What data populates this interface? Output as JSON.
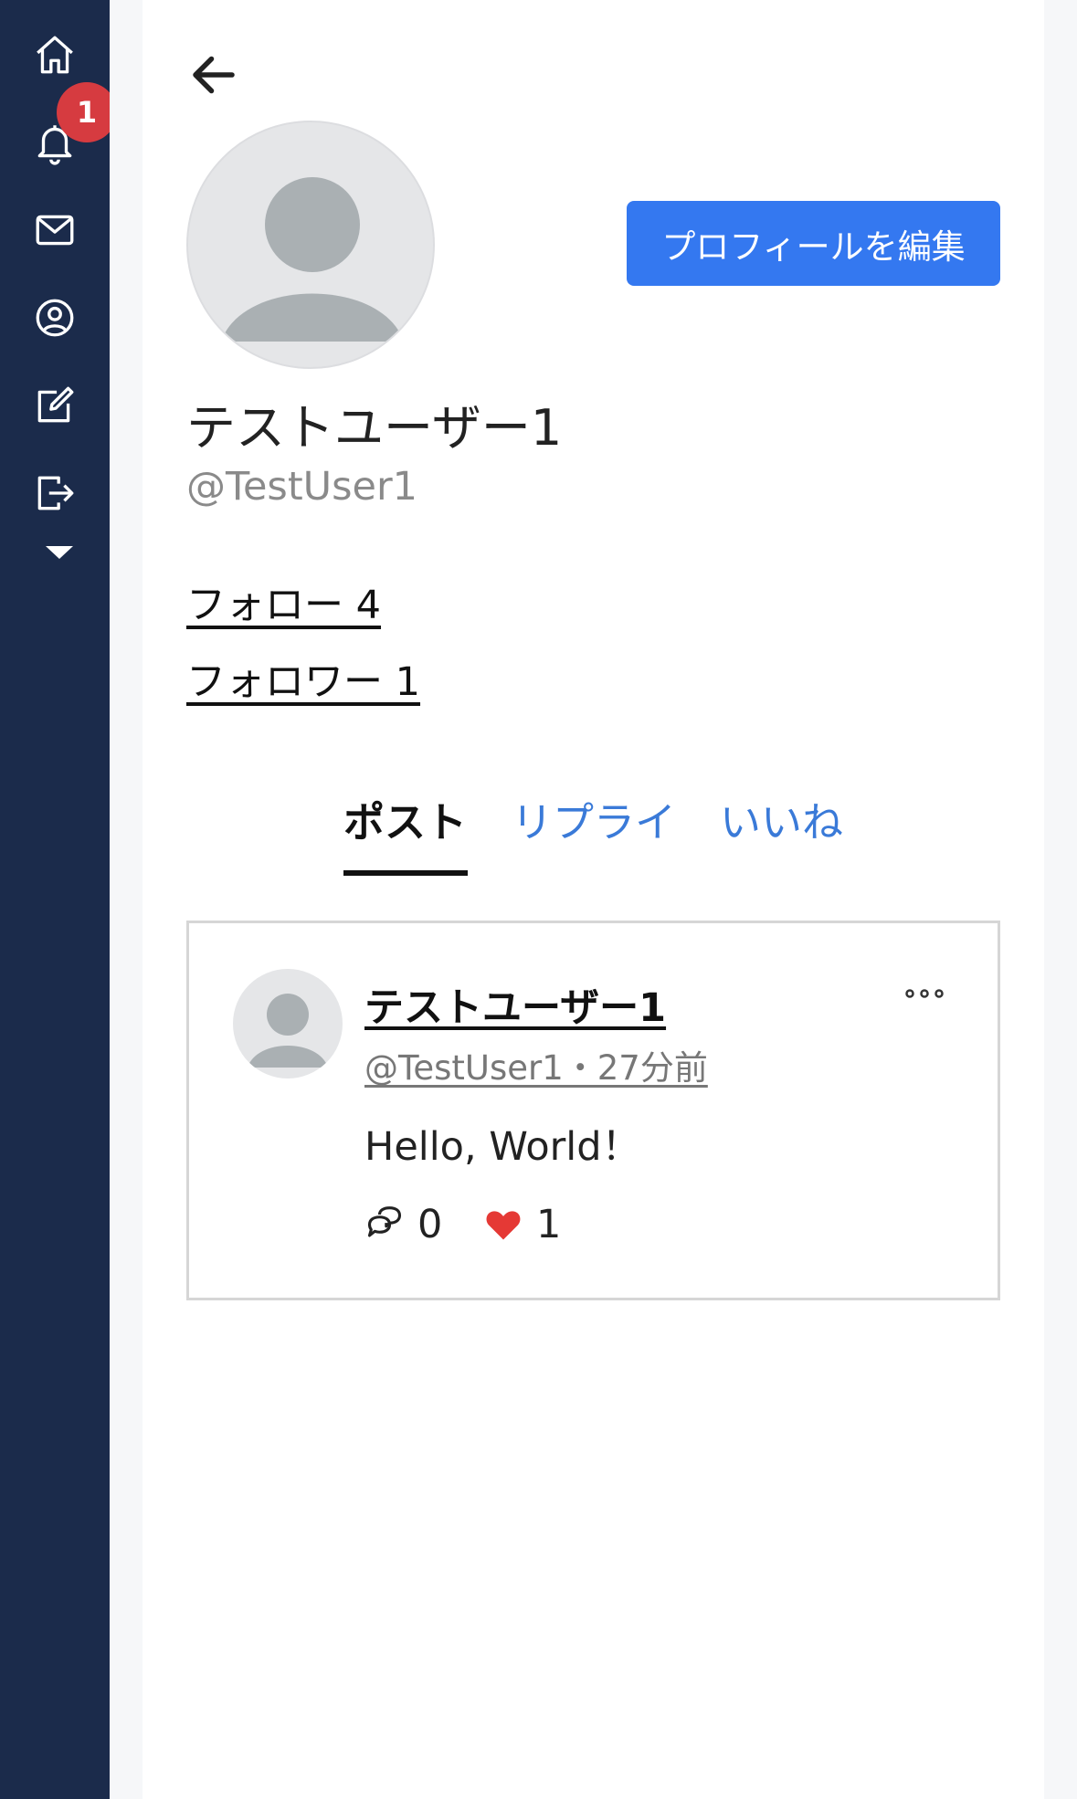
{
  "sidebar": {
    "icons": [
      "home-icon",
      "bell-icon",
      "mail-icon",
      "user-circle-icon",
      "edit-icon",
      "logout-icon"
    ],
    "notification_count": "1"
  },
  "profile": {
    "display_name": "テストユーザー1",
    "handle": "@TestUser1",
    "edit_button_label": "プロフィールを編集",
    "following_label": "フォロー 4",
    "followers_label": "フォロワー 1"
  },
  "tabs": [
    {
      "label": "ポスト",
      "active": true
    },
    {
      "label": "リプライ",
      "active": false
    },
    {
      "label": "いいね",
      "active": false
    }
  ],
  "posts": [
    {
      "author_name": "テストユーザー1",
      "meta": "@TestUser1・27分前",
      "text": "Hello, World！",
      "reply_count": "0",
      "like_count": "1"
    }
  ],
  "colors": {
    "sidebar_bg": "#1b2b4b",
    "accent": "#3478f0",
    "tab_link": "#3a7ad8",
    "badge": "#d63b40",
    "like": "#e53935"
  }
}
